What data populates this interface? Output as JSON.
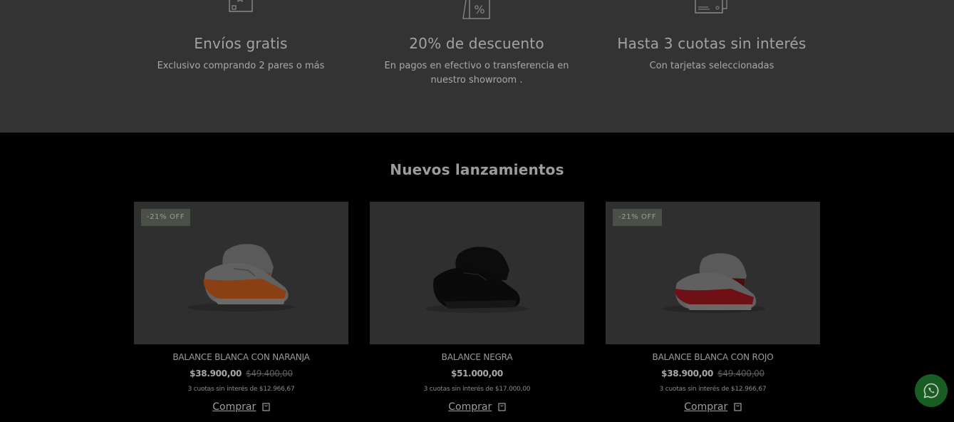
{
  "benefits": [
    {
      "icon": "shipping-box-icon",
      "title": "Envíos gratis",
      "desc": "Exclusivo comprando 2 pares o más"
    },
    {
      "icon": "discount-tag-icon",
      "title": "20% de descuento",
      "desc": "En pagos en efectivo o transferencia en nuestro showroom ."
    },
    {
      "icon": "credit-card-icon",
      "title": "Hasta 3 cuotas sin interés",
      "desc": "Con tarjetas seleccionadas"
    }
  ],
  "products": {
    "title": "Nuevos lanzamientos",
    "items": [
      {
        "badge": "-21% OFF",
        "name": "BALANCE BLANCA CON NARANJA",
        "price": "$38.900,00",
        "old_price": "$49.400,00",
        "installments": "3 cuotas sin interés de $12.966,67",
        "buy_label": "Comprar",
        "accent_color": "#c2571a"
      },
      {
        "badge": "",
        "name": "BALANCE NEGRA",
        "price": "$51.000,00",
        "old_price": "",
        "installments": "3 cuotas sin interés de $17.000,00",
        "buy_label": "Comprar",
        "accent_color": "#111111"
      },
      {
        "badge": "-21% OFF",
        "name": "BALANCE BLANCA CON ROJO",
        "price": "$38.900,00",
        "old_price": "$49.400,00",
        "installments": "3 cuotas sin interés de $12.966,67",
        "buy_label": "Comprar",
        "accent_color": "#7a1116"
      }
    ]
  },
  "whatsapp": {
    "icon": "whatsapp-icon",
    "color": "#185d22"
  }
}
